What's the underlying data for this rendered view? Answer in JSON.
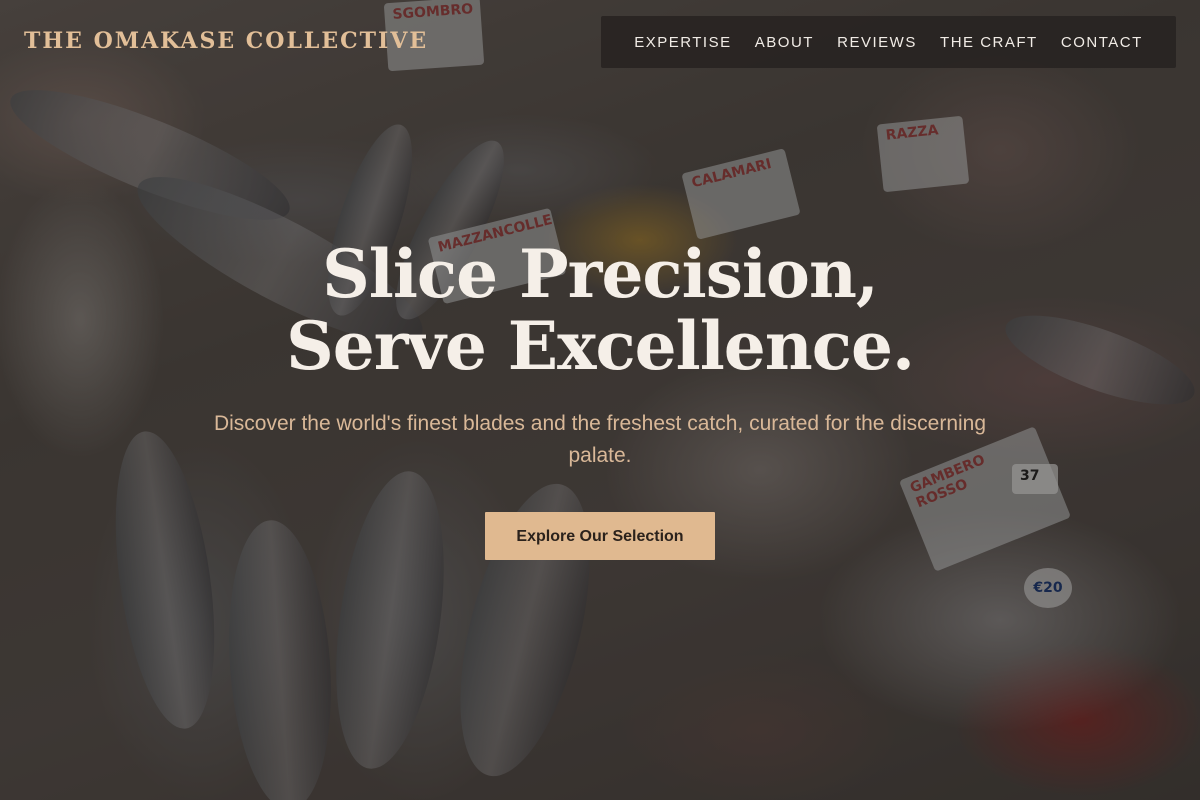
{
  "brand": {
    "name": "THE OMAKASE COLLECTIVE"
  },
  "nav": {
    "items": [
      {
        "label": "EXPERTISE"
      },
      {
        "label": "ABOUT"
      },
      {
        "label": "REVIEWS"
      },
      {
        "label": "THE CRAFT"
      },
      {
        "label": "CONTACT"
      }
    ]
  },
  "hero": {
    "headline": "Slice Precision, Serve Excellence.",
    "subheadline": "Discover the world's finest blades and the freshest catch, curated for the discerning palate.",
    "cta_label": "Explore Our Selection",
    "background_signs": [
      "SGOMBRO",
      "CALAMARI",
      "MAZZANCOLLE",
      "GAMBERO ROSSO",
      "RAZZA",
      "37",
      "€20"
    ]
  },
  "colors": {
    "brand_text": "#e2bf98",
    "nav_background": "#282422",
    "nav_text": "#f1ece6",
    "headline": "#f5efe8",
    "subheadline": "#d9b898",
    "cta_background": "#e0b990",
    "cta_text": "#2b221c"
  }
}
